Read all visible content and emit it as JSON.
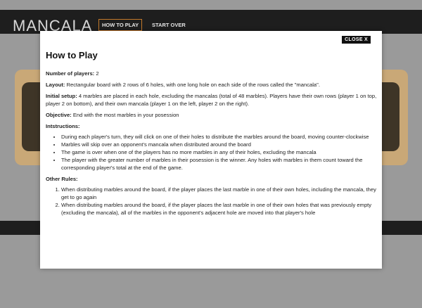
{
  "app": {
    "logo": "MANCALA",
    "nav": {
      "how_to_play": "HOW TO PLAY",
      "start_over": "START OVER"
    }
  },
  "modal": {
    "close": "CLOSE X",
    "title": "How to Play",
    "players_label": "Number of players:",
    "players_value": " 2",
    "layout_label": "Layout:",
    "layout_value": " Rectangular board with 2 rows of 6 holes, with one long hole on each side of the rows called the \"mancala\".",
    "setup_label": "Initial setup:",
    "setup_value": " 4 marbles are placed in each hole, excluding the mancalas (total of 48 marbles). Players have their own rows (player 1 on top, player 2 on bottom), and their own mancala (player 1 on the left, player 2 on the right).",
    "objective_label": "Objective:",
    "objective_value": " End with the most marbles in your posession",
    "instructions_head": "Intstructions:",
    "instructions": [
      "During each player's turn, they will click on one of their holes to distribute the marbles around the board, moving counter-clockwise",
      "Marbles will skip over an opponent's mancala when distributed around the board",
      "The game is over when one of the players has no more marbles in any of their holes, excluding the mancala",
      "The player with the greater number of marbles in their posession is the winner. Any holes with marbles in them count toward the corresponding player's total at the end of the game."
    ],
    "other_head": "Other Rules:",
    "other_rules": [
      "When distributing marbles around the board, if the player places the last marble in one of their own holes, including the mancala, they get to go again",
      "When distributing marbles around the board, if the player places the last marble in one of their own holes that was previously empty (excluding the mancala), all of the marbles in the opponent's adjacent hole are moved into that player's hole"
    ]
  }
}
